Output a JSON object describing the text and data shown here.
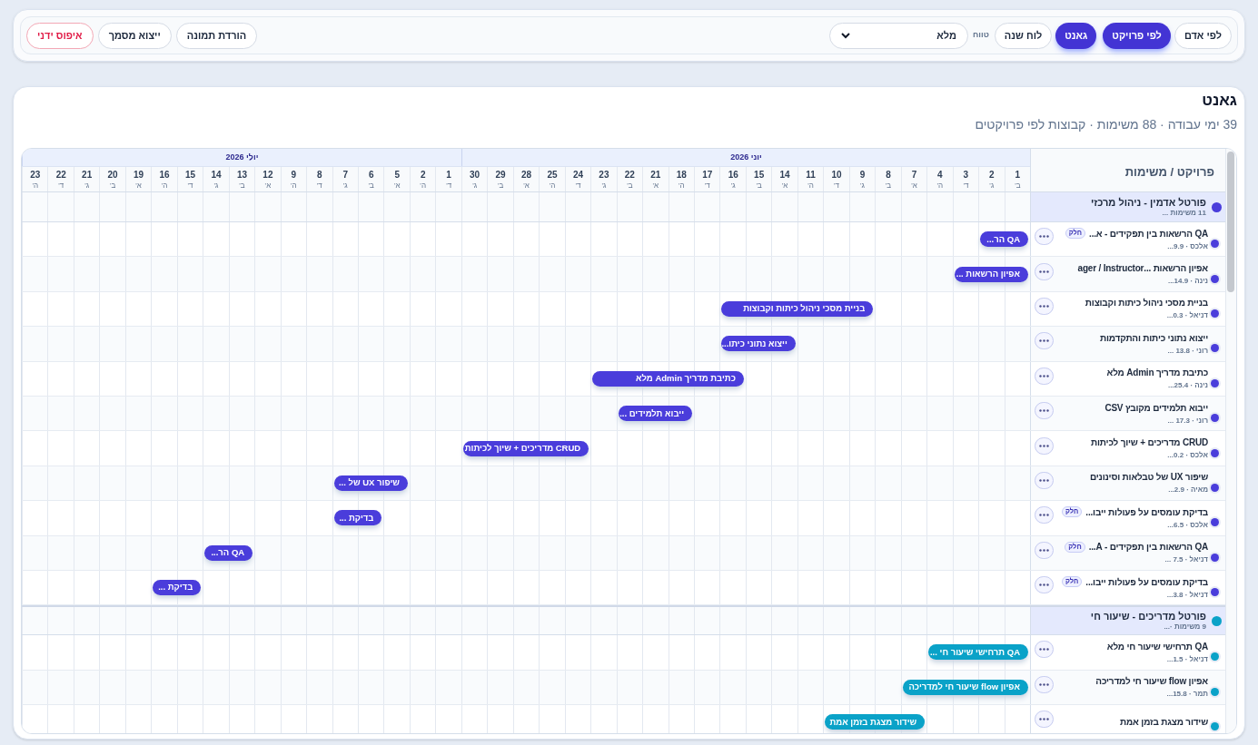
{
  "toolbar": {
    "view_tabs": [
      {
        "label": "לפי אדם",
        "selected": false
      },
      {
        "label": "לפי פרויקט",
        "selected": true
      }
    ],
    "mode_tabs": [
      {
        "label": "גאנט",
        "selected": true
      },
      {
        "label": "לוח שנה",
        "selected": false
      }
    ],
    "range_label": "טווח",
    "range_select": {
      "value": "מלא"
    },
    "actions": [
      {
        "label": "הורדת תמונה",
        "kind": "default"
      },
      {
        "label": "ייצוא מסמך",
        "kind": "default"
      },
      {
        "label": "איפוס ידני",
        "kind": "danger"
      }
    ]
  },
  "title": "גאנט",
  "subtitle": "39 ימי עבודה · 88 משימות · קבוצות לפי פרויקטים",
  "gantt": {
    "panel_header": "פרויקט / משימות",
    "months": [
      {
        "label": "יוני 2026",
        "days": [
          {
            "day": "1",
            "weekday": "ב'"
          },
          {
            "day": "2",
            "weekday": "ג'"
          },
          {
            "day": "3",
            "weekday": "ד'"
          },
          {
            "day": "4",
            "weekday": "ה'"
          },
          {
            "day": "7",
            "weekday": "א'"
          },
          {
            "day": "8",
            "weekday": "ב'"
          },
          {
            "day": "9",
            "weekday": "ג'"
          },
          {
            "day": "10",
            "weekday": "ד'"
          },
          {
            "day": "11",
            "weekday": "ה'"
          },
          {
            "day": "14",
            "weekday": "א'"
          },
          {
            "day": "15",
            "weekday": "ב'"
          },
          {
            "day": "16",
            "weekday": "ג'"
          },
          {
            "day": "17",
            "weekday": "ד'"
          },
          {
            "day": "18",
            "weekday": "ה'"
          },
          {
            "day": "21",
            "weekday": "א'"
          },
          {
            "day": "22",
            "weekday": "ב'"
          },
          {
            "day": "23",
            "weekday": "ג'"
          },
          {
            "day": "24",
            "weekday": "ד'"
          },
          {
            "day": "25",
            "weekday": "ה'"
          },
          {
            "day": "28",
            "weekday": "א'"
          },
          {
            "day": "29",
            "weekday": "ב'"
          },
          {
            "day": "30",
            "weekday": "ג'"
          }
        ]
      },
      {
        "label": "יולי 2026",
        "days": [
          {
            "day": "1",
            "weekday": "ד'"
          },
          {
            "day": "2",
            "weekday": "ה'"
          },
          {
            "day": "5",
            "weekday": "א'"
          },
          {
            "day": "6",
            "weekday": "ב'"
          },
          {
            "day": "7",
            "weekday": "ג'"
          },
          {
            "day": "8",
            "weekday": "ד'"
          },
          {
            "day": "9",
            "weekday": "ה'"
          },
          {
            "day": "12",
            "weekday": "א'"
          },
          {
            "day": "13",
            "weekday": "ב'"
          },
          {
            "day": "14",
            "weekday": "ג'"
          },
          {
            "day": "15",
            "weekday": "ד'"
          },
          {
            "day": "16",
            "weekday": "ה'"
          },
          {
            "day": "19",
            "weekday": "א'"
          },
          {
            "day": "20",
            "weekday": "ב'"
          },
          {
            "day": "21",
            "weekday": "ג'"
          },
          {
            "day": "22",
            "weekday": "ד'"
          },
          {
            "day": "23",
            "weekday": "ה'"
          }
        ]
      }
    ],
    "groups": [
      {
        "name": "פורטל אדמין - ניהול מרכזי",
        "meta": "11 משימות ...",
        "color": "#4a3ddb",
        "tasks": [
          {
            "name": "QA הרשאות בין תפקידים - א...",
            "badge": "חלק",
            "meta": "אלכס · 9.9...",
            "bar": {
              "label": "QA הר..."
            }
          },
          {
            "name": "אפיון הרשאות ...ager / Instructor",
            "meta": "נינה · 14.9...",
            "bar": {
              "label": "אפיון הרשאות ..."
            }
          },
          {
            "name": "בניית מסכי ניהול כיתות וקבוצות",
            "meta": "דניאל · 0.3...",
            "bar": {
              "label": "בניית מסכי ניהול כיתות וקבוצות"
            }
          },
          {
            "name": "ייצוא נתוני כיתות והתקדמות",
            "meta": "רוני · 13.8 ...",
            "bar": {
              "label": "ייצוא נתוני כיתו..."
            }
          },
          {
            "name": "כתיבת מדריך Admin מלא",
            "meta": "נינה · 25.4...",
            "bar": {
              "label": "כתיבת מדריך Admin מלא"
            }
          },
          {
            "name": "ייבוא תלמידים מקובץ CSV",
            "meta": "רוני · 17.3 ...",
            "bar": {
              "label": "ייבוא תלמידים ..."
            }
          },
          {
            "name": "CRUD מדריכים + שיוך לכיתות",
            "meta": "אלכס · 0.2...",
            "bar": {
              "label": "CRUD מדריכים + שיוך לכיתות"
            }
          },
          {
            "name": "שיפור UX של טבלאות וסינונים",
            "meta": "מאיה · 2.9...",
            "bar": {
              "label": "שיפור UX של ..."
            }
          },
          {
            "name": "בדיקת עומסים על פעולות ייבו...",
            "badge": "חלק",
            "meta": "אלכס · 6.5...",
            "bar": {
              "label": "בדיקת ..."
            }
          },
          {
            "name": "QA הרשאות בין תפקידים - A...",
            "badge": "חלק",
            "meta": "דניאל · 7.5 ...",
            "bar": {
              "label": "QA הר..."
            }
          },
          {
            "name": "בדיקת עומסים על פעולות ייבו...",
            "badge": "חלק",
            "meta": "דניאל · 3.8...",
            "bar": {
              "label": "בדיקת ..."
            }
          }
        ]
      },
      {
        "name": "פורטל מדריכים - שיעור חי",
        "meta": "9 משימות ·...",
        "color": "#0aa2c8",
        "tasks": [
          {
            "name": "QA תרחישי שיעור חי מלא",
            "meta": "דניאל · 1.5...",
            "bar": {
              "label": "QA תרחישי שיעור חי ..."
            }
          },
          {
            "name": "אפיון flow שיעור חי למדריכה",
            "meta": "תמר · 15.8...",
            "bar": {
              "label": "אפיון flow שיעור חי למדריכה"
            }
          },
          {
            "name": "שידור מצגת בזמן אמת",
            "bar": {
              "label": "שידור מצגת בזמן אמת"
            }
          }
        ]
      }
    ]
  }
}
